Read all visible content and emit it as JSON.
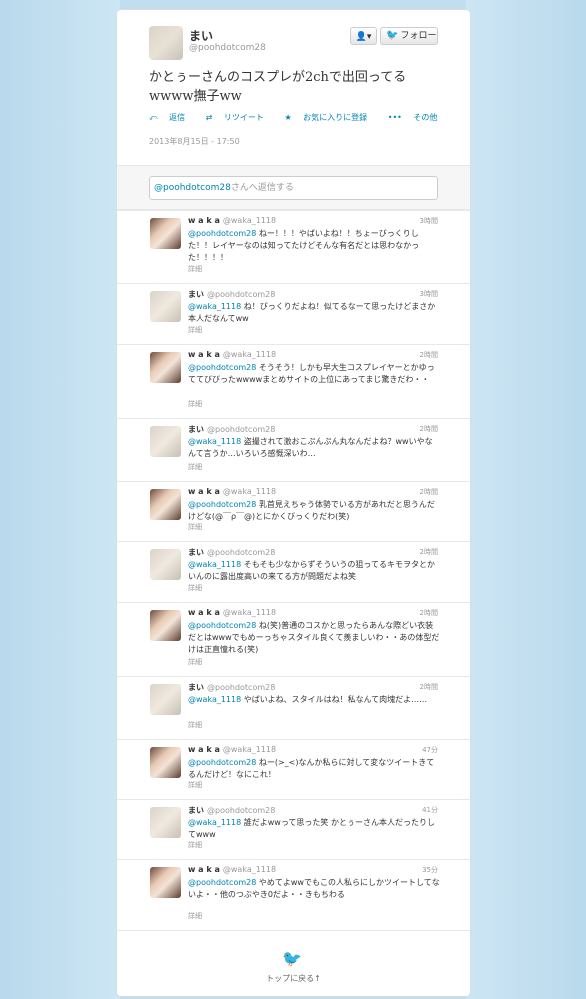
{
  "header": {
    "name": "まい",
    "handle": "@poohdotcom28",
    "user_button": "👤▾",
    "follow_label": "フォロー",
    "tweet": "かとぅーさんのコスプレが2chで出回ってるwwww撫子ww",
    "actions": {
      "reply": "返信",
      "retweet": "リツイート",
      "favorite": "お気に入りに登録",
      "more": "その他"
    },
    "date": "2013年8月15日 - 17:50"
  },
  "reply_box": {
    "mention": "@poohdotcom28",
    "placeholder_rest": "さんへ返信する"
  },
  "replies": [
    {
      "name": "w a k a",
      "handle": "@waka_1118",
      "time": "3時間",
      "mention": "@poohdotcom28",
      "text": " ねー！！！やばいよね！！ちょーびっくりした！！レイヤーなのは知ってたけどそんな有名だとは思わなかった！！！！",
      "detail": "詳細"
    },
    {
      "name": "まい",
      "handle": "@poohdotcom28",
      "time": "3時間",
      "mention": "@waka_1118",
      "text": " ね！びっくりだよね！似てるなーて思ったけどまさか本人だなんてww",
      "detail": "詳細"
    },
    {
      "name": "w a k a",
      "handle": "@waka_1118",
      "time": "2時間",
      "mention": "@poohdotcom28",
      "text": " そうそう！しかも早大生コスプレイヤーとかゆっててびびったwwwwまとめサイトの上位にあってまじ驚きだわ・・",
      "detail": "詳細"
    },
    {
      "name": "まい",
      "handle": "@poohdotcom28",
      "time": "2時間",
      "mention": "@waka_1118",
      "text": " 盗撮されて激おこぷんぷん丸なんだよね？wwいやなんて言うか…いろいろ感慨深いわ…",
      "detail": "詳細"
    },
    {
      "name": "w a k a",
      "handle": "@waka_1118",
      "time": "2時間",
      "mention": "@poohdotcom28",
      "text": " 乳首見えちゃう体勢でいる方があれだと思うんだけどな(@￣ρ￣@)とにかくびっくりだわ(笑)",
      "detail": "詳細"
    },
    {
      "name": "まい",
      "handle": "@poohdotcom28",
      "time": "2時間",
      "mention": "@waka_1118",
      "text": " そもそも少なからずそういうの狙ってるキモヲタとかいんのに露出度高いの来てる方が問題だよね笑",
      "detail": "詳細"
    },
    {
      "name": "w a k a",
      "handle": "@waka_1118",
      "time": "2時間",
      "mention": "@poohdotcom28",
      "text": " ね(笑)普通のコスかと思ったらあんな際どい衣装だとはwwwでもめーっちゃスタイル良くて羨ましいわ・・あの体型だけは正直憧れる(笑)",
      "detail": "詳細"
    },
    {
      "name": "まい",
      "handle": "@poohdotcom28",
      "time": "2時間",
      "mention": "@waka_1118",
      "text": " やばいよね、スタイルはね！私なんて肉塊だよ……",
      "detail": "詳細"
    },
    {
      "name": "w a k a",
      "handle": "@waka_1118",
      "time": "47分",
      "mention": "@poohdotcom28",
      "text": " ねー(>_<)なんか私らに対して変なツイートきてるんだけど！なにこれ！",
      "detail": "詳細"
    },
    {
      "name": "まい",
      "handle": "@poohdotcom28",
      "time": "41分",
      "mention": "@waka_1118",
      "text": " 誰だよwwって思った笑 かとぅーさん本人だったりしてwww",
      "detail": "詳細"
    },
    {
      "name": "w a k a",
      "handle": "@waka_1118",
      "time": "35分",
      "mention": "@poohdotcom28",
      "text": " やめてよwwでもこの人私らにしかツイートしてないよ・・他のつぶやき0だよ・・きもちわる",
      "detail": "詳細"
    }
  ],
  "footer": {
    "back_to_top": "トップに戻る↑"
  }
}
